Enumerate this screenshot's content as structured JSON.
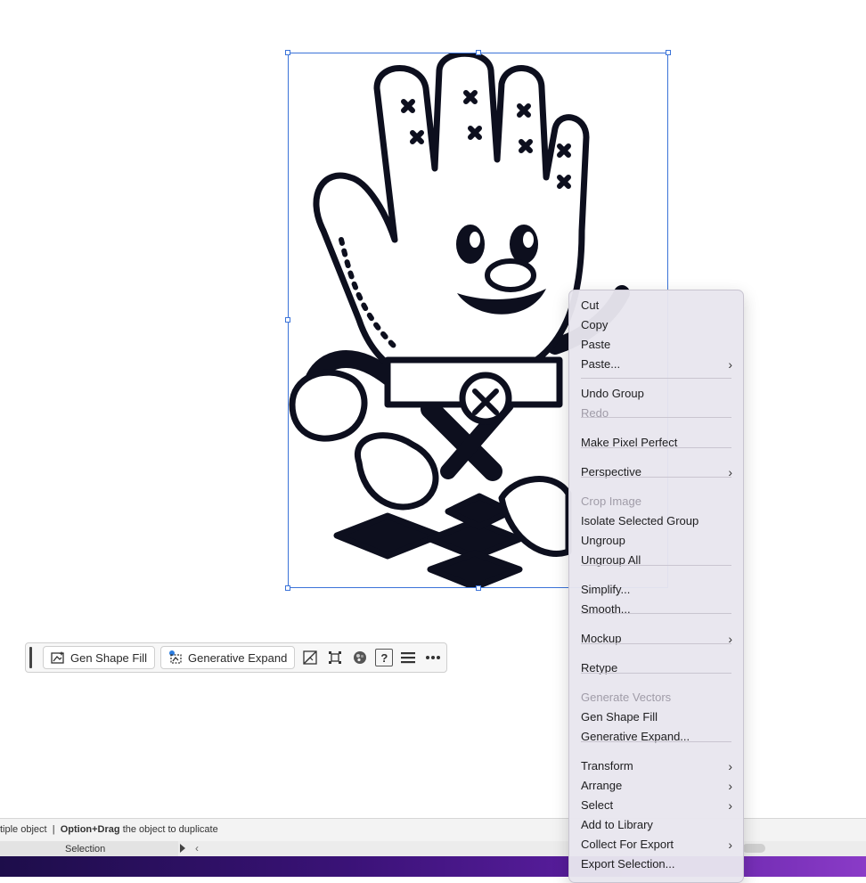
{
  "taskbar": {
    "gen_shape_fill": "Gen Shape Fill",
    "generative_expand": "Generative Expand",
    "help_glyph": "?",
    "icons": [
      "gen-shape-fill-icon",
      "generative-expand-icon",
      "mask-icon",
      "transform-icon",
      "recolor-icon",
      "help-icon",
      "menu-icon",
      "more-icon"
    ]
  },
  "status": {
    "prefix": "tiple object",
    "divider": "|",
    "hint_key": "Option+Drag",
    "hint_text": "the object to duplicate",
    "tool": "Selection"
  },
  "menu": {
    "items": [
      {
        "label": "Cut",
        "disabled": false,
        "submenu": false
      },
      {
        "label": "Copy",
        "disabled": false,
        "submenu": false
      },
      {
        "label": "Paste",
        "disabled": false,
        "submenu": false
      },
      {
        "label": "Paste...",
        "disabled": false,
        "submenu": true
      },
      {
        "label": "Undo Group",
        "disabled": false,
        "submenu": false
      },
      {
        "label": "Redo",
        "disabled": true,
        "submenu": false
      },
      {
        "label": "Make Pixel Perfect",
        "disabled": false,
        "submenu": false
      },
      {
        "label": "Perspective",
        "disabled": false,
        "submenu": true
      },
      {
        "label": "Crop Image",
        "disabled": true,
        "submenu": false
      },
      {
        "label": "Isolate Selected Group",
        "disabled": false,
        "submenu": false
      },
      {
        "label": "Ungroup",
        "disabled": false,
        "submenu": false
      },
      {
        "label": "Ungroup All",
        "disabled": false,
        "submenu": false
      },
      {
        "label": "Simplify...",
        "disabled": false,
        "submenu": false
      },
      {
        "label": "Smooth...",
        "disabled": false,
        "submenu": false
      },
      {
        "label": "Mockup",
        "disabled": false,
        "submenu": true
      },
      {
        "label": "Retype",
        "disabled": false,
        "submenu": false
      },
      {
        "label": "Generate Vectors",
        "disabled": true,
        "submenu": false
      },
      {
        "label": "Gen Shape Fill",
        "disabled": false,
        "submenu": false
      },
      {
        "label": "Generative Expand...",
        "disabled": false,
        "submenu": false
      },
      {
        "label": "Transform",
        "disabled": false,
        "submenu": true
      },
      {
        "label": "Arrange",
        "disabled": false,
        "submenu": true
      },
      {
        "label": "Select",
        "disabled": false,
        "submenu": true
      },
      {
        "label": "Add to Library",
        "disabled": false,
        "submenu": false
      },
      {
        "label": "Collect For Export",
        "disabled": false,
        "submenu": true
      },
      {
        "label": "Export Selection...",
        "disabled": false,
        "submenu": false
      }
    ],
    "submenu_glyph": "›"
  },
  "colors": {
    "selection": "#3b73d8",
    "menu_bg": "#e8e6ee",
    "disabled_text": "#a09ca8",
    "artwork_ink": "#0d0f1e"
  }
}
